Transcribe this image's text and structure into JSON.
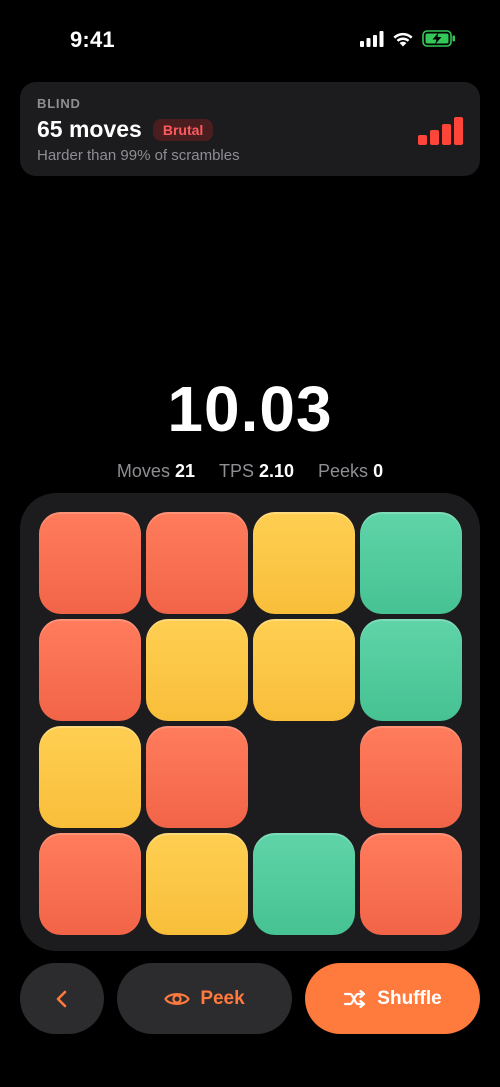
{
  "status": {
    "time": "9:41"
  },
  "difficulty": {
    "mode": "BLIND",
    "moves": "65 moves",
    "level": "Brutal",
    "subtitle": "Harder than 99% of scrambles",
    "level_color": "#ff453a",
    "strength_bars": 4,
    "strength_bars_filled": 4
  },
  "timer": {
    "value": "10.03"
  },
  "stats": {
    "moves_label": "Moves",
    "moves_value": "21",
    "tps_label": "TPS",
    "tps_value": "2.10",
    "peeks_label": "Peeks",
    "peeks_value": "0"
  },
  "board": {
    "colors": {
      "red": "#f26b4e",
      "yellow": "#fcc746",
      "green": "#52cb9d"
    },
    "rows": [
      [
        "red",
        "red",
        "yellow",
        "green"
      ],
      [
        "red",
        "yellow",
        "yellow",
        "green"
      ],
      [
        "yellow",
        "red",
        "empty",
        "red"
      ],
      [
        "red",
        "yellow",
        "green",
        "red"
      ]
    ]
  },
  "actions": {
    "back_icon": "chevron-left-icon",
    "peek_label": "Peek",
    "peek_icon": "eye-icon",
    "shuffle_label": "Shuffle",
    "shuffle_icon": "shuffle-icon",
    "accent": "#ff7a3d"
  }
}
